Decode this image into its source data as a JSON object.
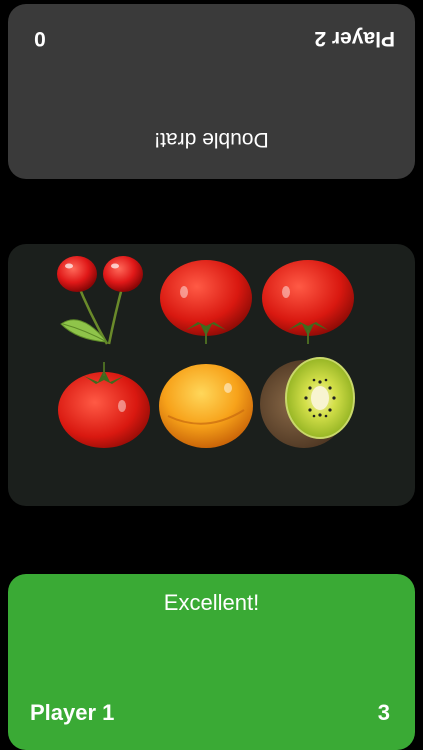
{
  "player2": {
    "name": "Player 2",
    "score": "0",
    "message": "Double drat!"
  },
  "board": {
    "cards": [
      {
        "icon": "cherries-icon"
      },
      {
        "icon": "tomato-icon"
      },
      {
        "icon": "tomato-icon"
      },
      {
        "icon": "tomato-icon"
      },
      {
        "icon": "apricot-icon"
      },
      {
        "icon": "kiwi-icon"
      }
    ]
  },
  "player1": {
    "name": "Player 1",
    "score": "3",
    "message": "Excellent!"
  },
  "colors": {
    "player1_panel": "#3aaa35",
    "player2_panel": "#3a3a3a",
    "board": "#1b1f1c"
  }
}
